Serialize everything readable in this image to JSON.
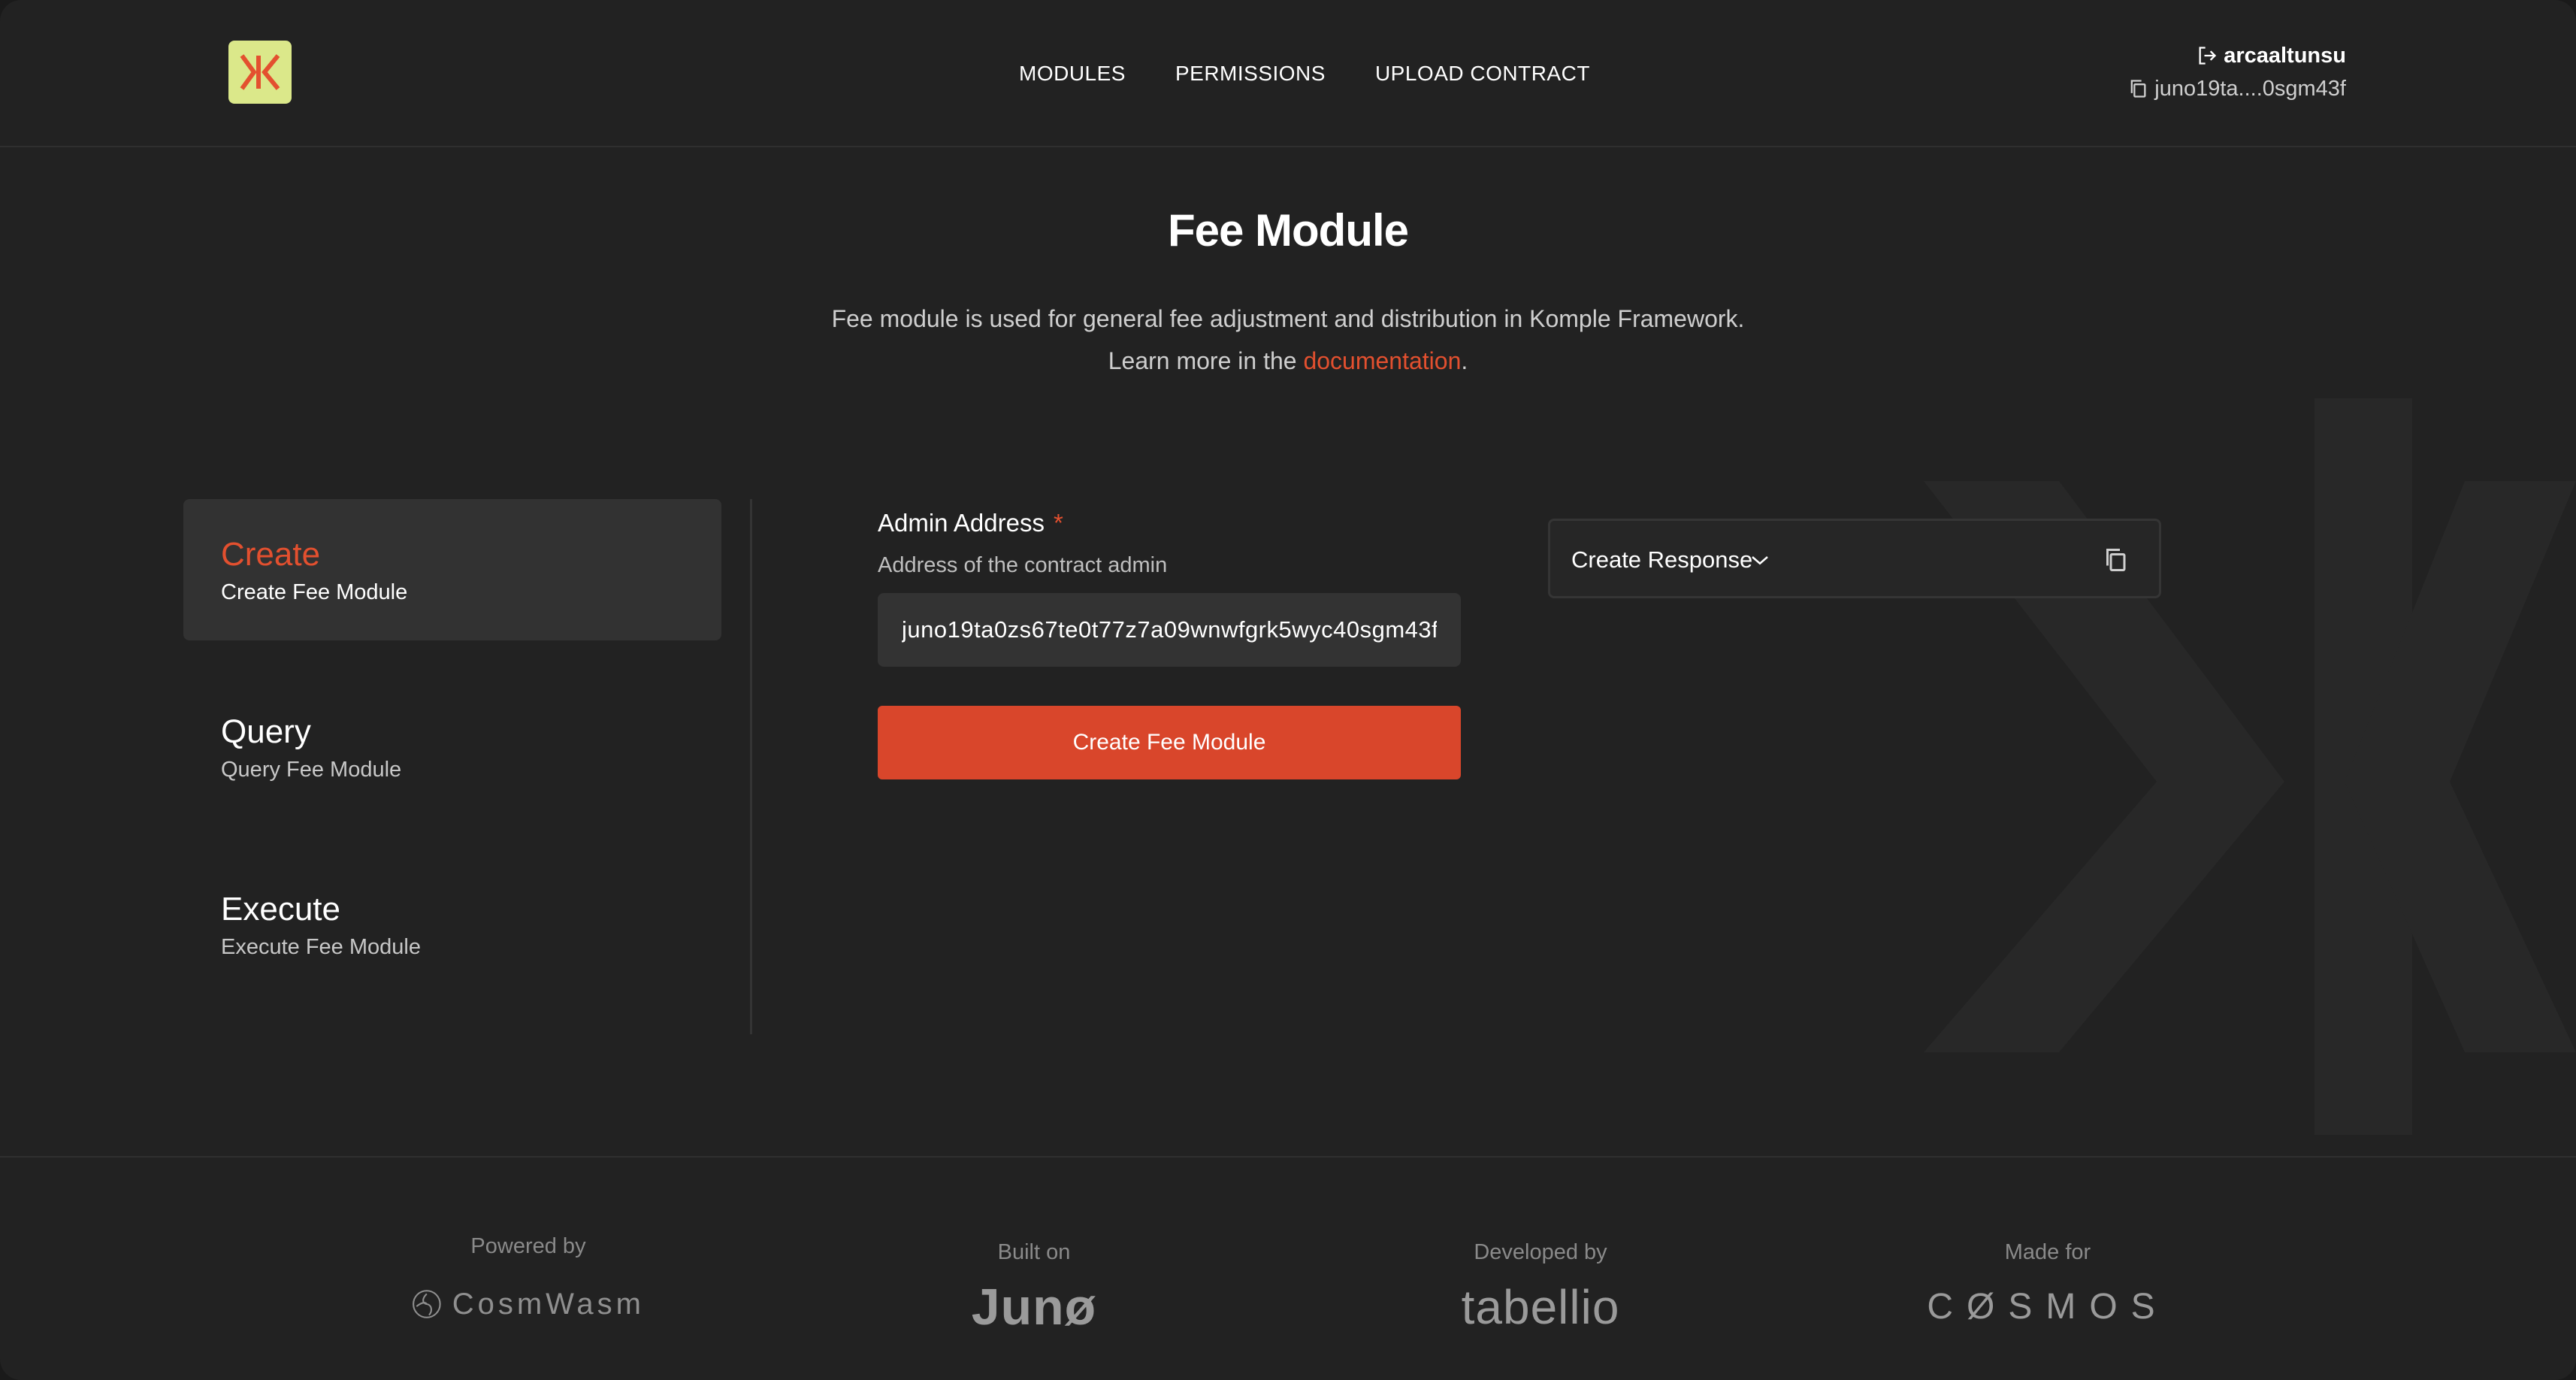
{
  "app": {
    "logo_alt": "Komple",
    "colors": {
      "accent": "#e3502f",
      "button": "#d9462b",
      "logo_bg": "#dbe88a",
      "background": "#222222"
    }
  },
  "nav": {
    "items": [
      {
        "label": "MODULES"
      },
      {
        "label": "PERMISSIONS"
      },
      {
        "label": "UPLOAD CONTRACT"
      }
    ]
  },
  "user": {
    "name": "arcaaltunsu",
    "wallet": "juno19ta....0sgm43f",
    "logout_icon": "logout-icon",
    "copy_icon": "copy-icon"
  },
  "page": {
    "title": "Fee Module",
    "description_line1": "Fee module is used for general fee adjustment and distribution in Komple Framework.",
    "description_line2_prefix": "Learn more in the ",
    "description_link": "documentation",
    "description_line2_suffix": "."
  },
  "sidebar": {
    "items": [
      {
        "title": "Create",
        "subtitle": "Create Fee Module",
        "active": true
      },
      {
        "title": "Query",
        "subtitle": "Query Fee Module",
        "active": false
      },
      {
        "title": "Execute",
        "subtitle": "Execute Fee Module",
        "active": false
      }
    ]
  },
  "form": {
    "admin_label": "Admin Address",
    "required_mark": "*",
    "admin_help": "Address of the contract admin",
    "admin_value": "juno19ta0zs67te0t77z7a09wnwfgrk5wyc40sgm43f",
    "submit_label": "Create Fee Module"
  },
  "response": {
    "label": "Create Response",
    "chevron_icon": "chevron-down-icon",
    "copy_icon": "copy-icon"
  },
  "footer": {
    "columns": [
      {
        "caption": "Powered by",
        "brand": "CosmWasm"
      },
      {
        "caption": "Built on",
        "brand": "Junø"
      },
      {
        "caption": "Developed by",
        "brand": "tabellio"
      },
      {
        "caption": "Made for",
        "brand": "CØSMOS"
      }
    ]
  }
}
